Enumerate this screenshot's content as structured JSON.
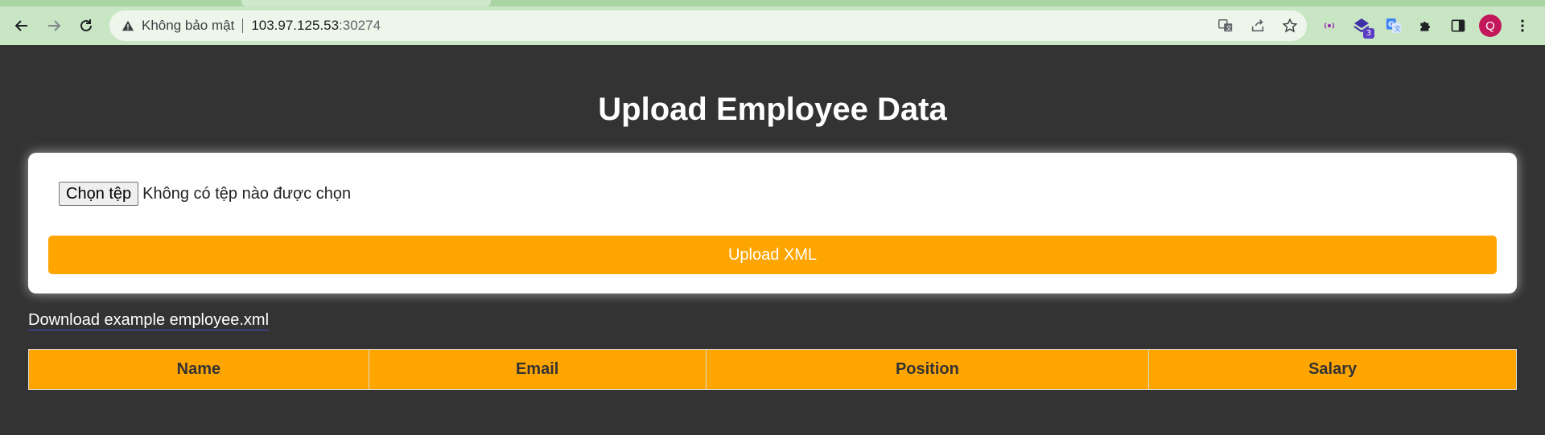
{
  "browser": {
    "security_label": "Không bảo mật",
    "url_host": "103.97.125.53",
    "url_port": ":30274",
    "extension_badge": "3",
    "profile_initial": "Q"
  },
  "page": {
    "title": "Upload Employee Data",
    "file_picker": {
      "button_label": "Chọn tệp",
      "status_text": "Không có tệp nào được chọn"
    },
    "upload_button_label": "Upload XML",
    "download_link_text": "Download example employee.xml",
    "table": {
      "headers": [
        "Name",
        "Email",
        "Position",
        "Salary"
      ]
    }
  },
  "colors": {
    "accent": "#ffa500",
    "background": "#333333",
    "toolbar": "#c9e6c4"
  }
}
